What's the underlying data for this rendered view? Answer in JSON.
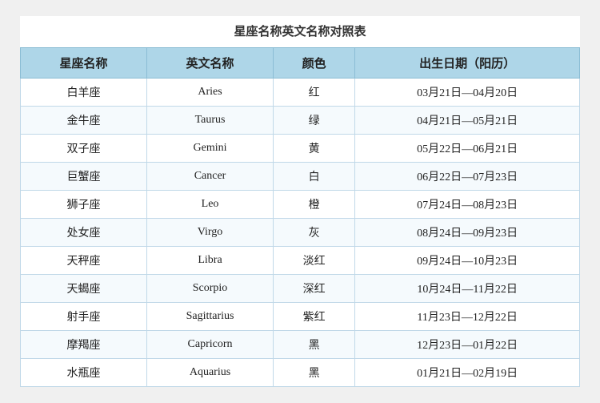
{
  "title": "星座名称英文名称对照表",
  "table": {
    "headers": [
      "星座名称",
      "英文名称",
      "颜色",
      "出生日期（阳历）"
    ],
    "rows": [
      {
        "chinese": "白羊座",
        "english": "Aries",
        "color": "红",
        "date": "03月21日—04月20日"
      },
      {
        "chinese": "金牛座",
        "english": "Taurus",
        "color": "绿",
        "date": "04月21日—05月21日"
      },
      {
        "chinese": "双子座",
        "english": "Gemini",
        "color": "黄",
        "date": "05月22日—06月21日"
      },
      {
        "chinese": "巨蟹座",
        "english": "Cancer",
        "color": "白",
        "date": "06月22日—07月23日"
      },
      {
        "chinese": "狮子座",
        "english": "Leo",
        "color": "橙",
        "date": "07月24日—08月23日"
      },
      {
        "chinese": "处女座",
        "english": "Virgo",
        "color": "灰",
        "date": "08月24日—09月23日"
      },
      {
        "chinese": "天秤座",
        "english": "Libra",
        "color": "淡红",
        "date": "09月24日—10月23日"
      },
      {
        "chinese": "天蝎座",
        "english": "Scorpio",
        "color": "深红",
        "date": "10月24日—11月22日"
      },
      {
        "chinese": "射手座",
        "english": "Sagittarius",
        "color": "紫红",
        "date": "11月23日—12月22日"
      },
      {
        "chinese": "摩羯座",
        "english": "Capricorn",
        "color": "黑",
        "date": "12月23日—01月22日"
      },
      {
        "chinese": "水瓶座",
        "english": "Aquarius",
        "color": "黑",
        "date": "01月21日—02月19日"
      }
    ]
  }
}
